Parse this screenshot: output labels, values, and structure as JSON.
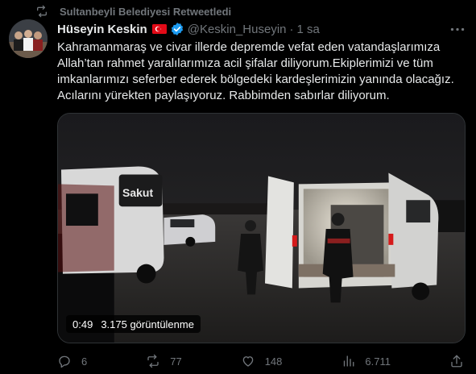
{
  "retweet": {
    "label": "Sultanbeyli Belediyesi Retweetledi",
    "icon": "retweet-icon"
  },
  "tweet": {
    "author_name": "Hüseyin Keskin",
    "flag_icon": "turkey-flag-icon",
    "verified_icon": "verified-badge-icon",
    "handle": "@Keskin_Huseyin",
    "separator": "·",
    "time": "1 sa",
    "text": "Kahramanmaraş ve civar illerde depremde vefat eden vatandaşlarımıza\nAllah’tan rahmet yaralılarımıza acil şifalar diliyorum.Ekiplerimizi ve tüm\nimkanlarımızı seferber ederek bölgedeki kardeşlerimizin yanında olacağız.\nAcılarını yürekten paylaşıyoruz. Rabbimden sabırlar diliyorum.",
    "video": {
      "duration": "0:49",
      "views": "3.175 görüntülenme",
      "bus_sign": "Sakut"
    },
    "actions": {
      "replies": "6",
      "retweets": "77",
      "likes": "148",
      "views": "6.711"
    }
  },
  "colors": {
    "background": "#000000",
    "text_primary": "#e7e9ea",
    "text_secondary": "#71767b",
    "verified": "#1d9bf0",
    "flag": "#e30a17"
  }
}
